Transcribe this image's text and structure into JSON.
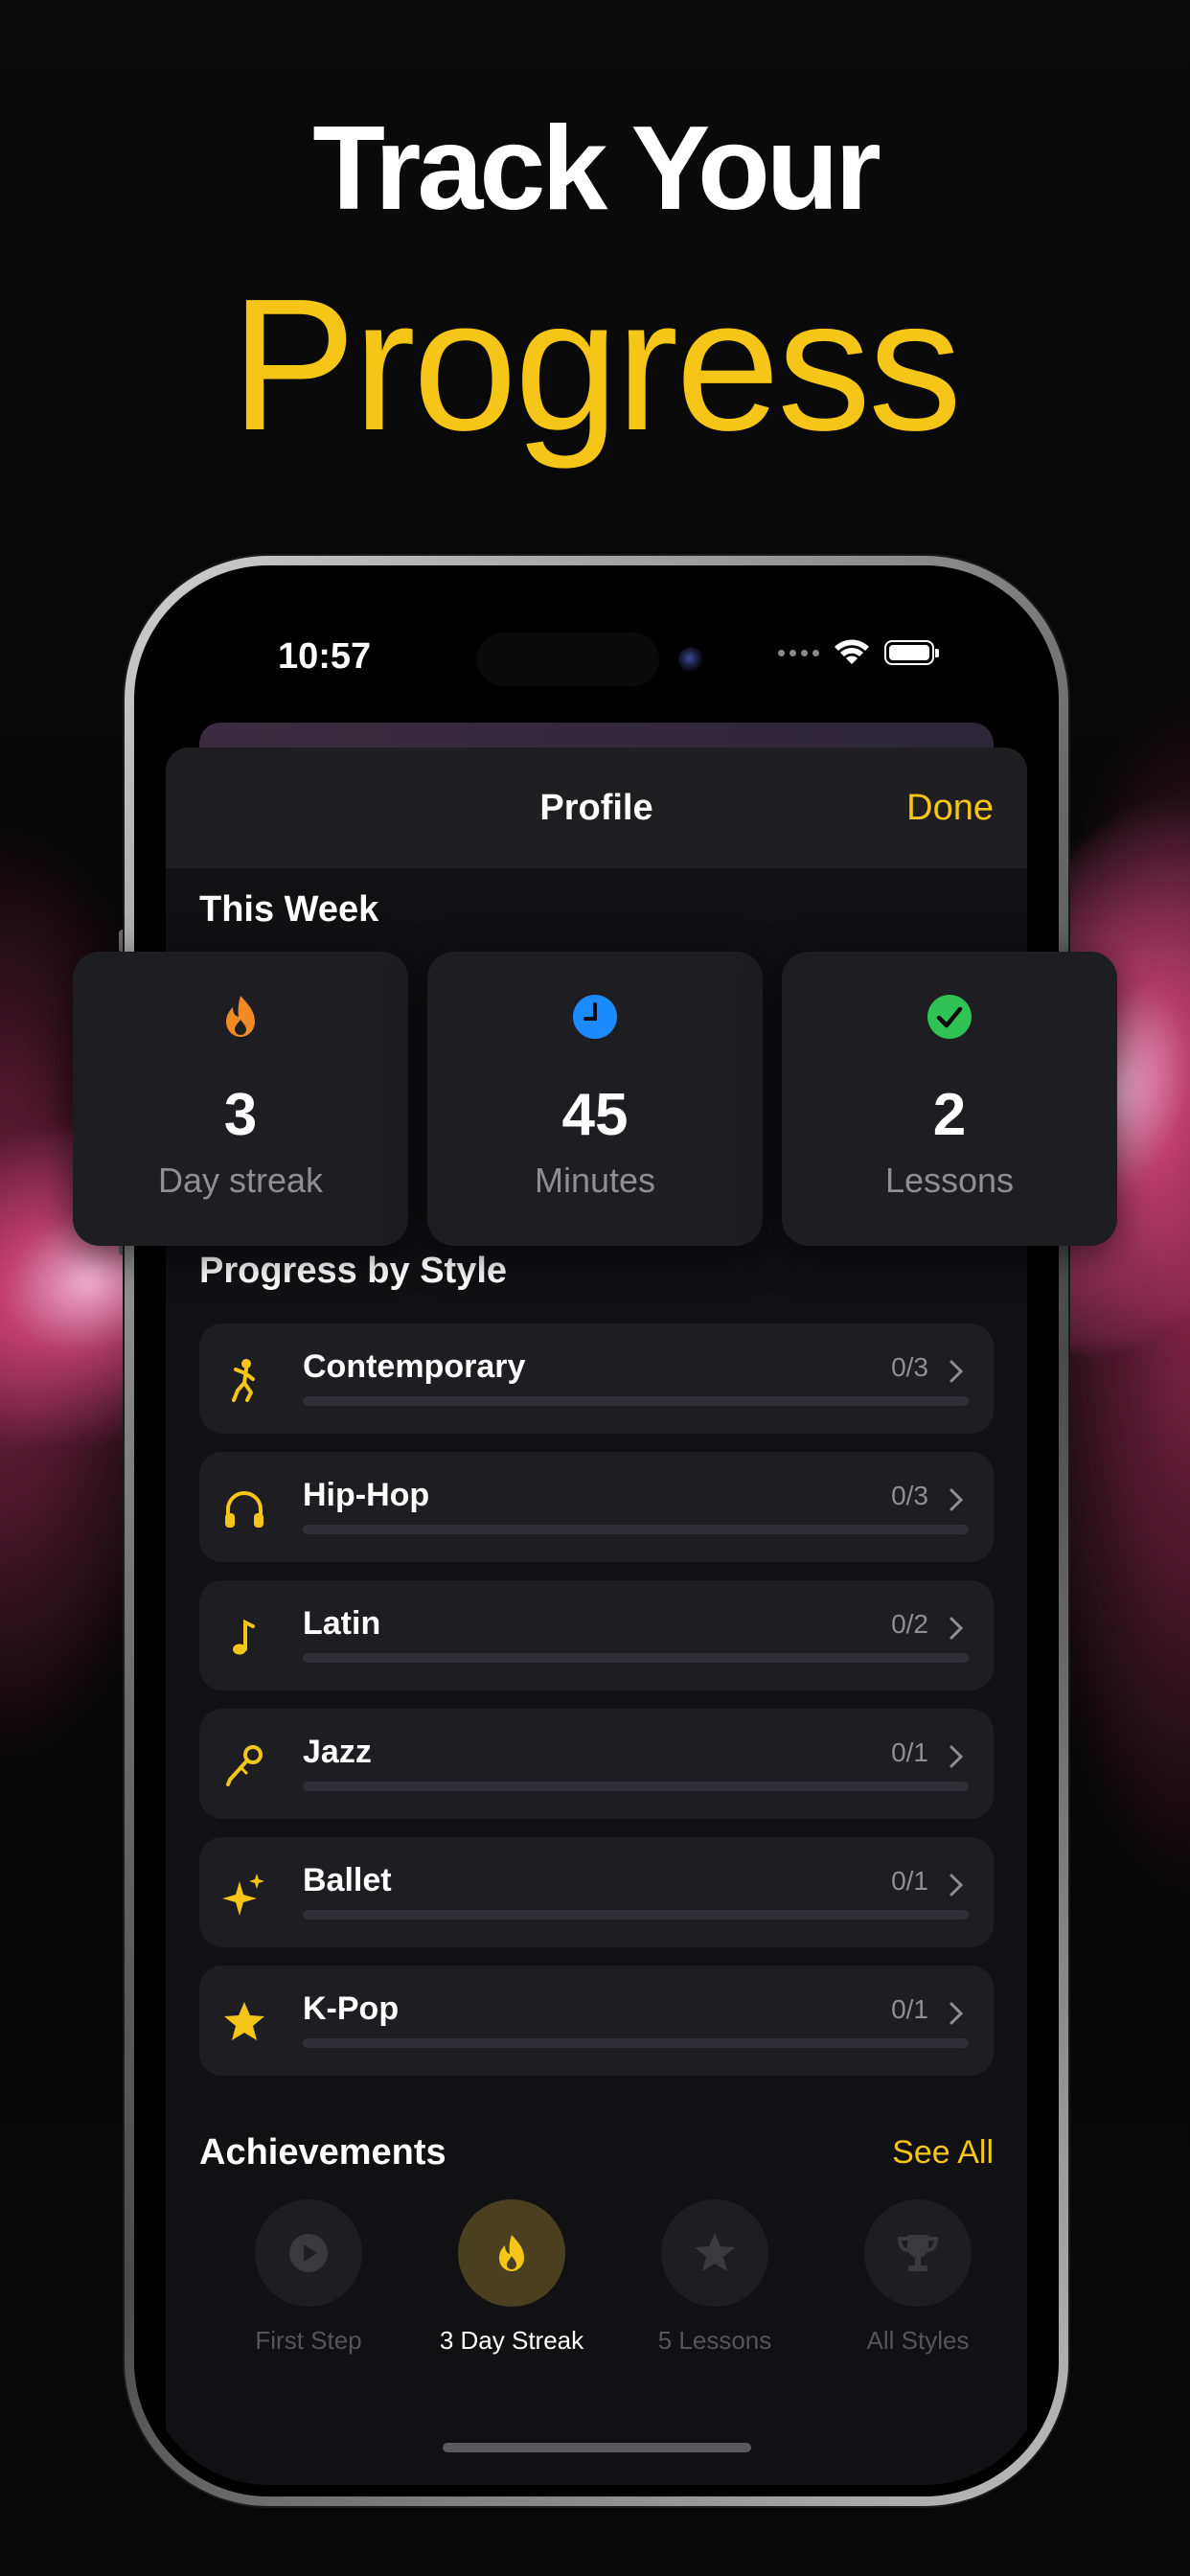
{
  "headline": {
    "line1": "Track Your",
    "line2": "Progress"
  },
  "status_bar": {
    "time": "10:57"
  },
  "nav": {
    "title": "Profile",
    "done_label": "Done"
  },
  "this_week": {
    "title": "This Week",
    "stats": [
      {
        "icon": "flame-icon",
        "value": "3",
        "label": "Day streak",
        "color": "#f08a24"
      },
      {
        "icon": "clock-icon",
        "value": "45",
        "label": "Minutes",
        "color": "#1a8cff"
      },
      {
        "icon": "checkmark-circle-icon",
        "value": "2",
        "label": "Lessons",
        "color": "#30c254"
      }
    ]
  },
  "progress_by_style": {
    "title": "Progress by Style",
    "items": [
      {
        "name": "Contemporary",
        "count": "0/3",
        "icon": "dancer-icon",
        "progress": 0
      },
      {
        "name": "Hip-Hop",
        "count": "0/3",
        "icon": "headphones-icon",
        "progress": 0
      },
      {
        "name": "Latin",
        "count": "0/2",
        "icon": "music-note-icon",
        "progress": 0
      },
      {
        "name": "Jazz",
        "count": "0/1",
        "icon": "microphone-icon",
        "progress": 0
      },
      {
        "name": "Ballet",
        "count": "0/1",
        "icon": "sparkles-icon",
        "progress": 0
      },
      {
        "name": "K-Pop",
        "count": "0/1",
        "icon": "star-icon",
        "progress": 0
      }
    ]
  },
  "achievements": {
    "title": "Achievements",
    "see_all_label": "See All",
    "items": [
      {
        "label": "First Step",
        "icon": "play-icon",
        "unlocked": false
      },
      {
        "label": "3 Day Streak",
        "icon": "flame-icon",
        "unlocked": true
      },
      {
        "label": "5 Lessons",
        "icon": "star-icon",
        "unlocked": false
      },
      {
        "label": "All Styles",
        "icon": "trophy-icon",
        "unlocked": false
      }
    ]
  },
  "colors": {
    "accent": "#f5c518",
    "background": "#111114",
    "card": "#1e1e22"
  }
}
